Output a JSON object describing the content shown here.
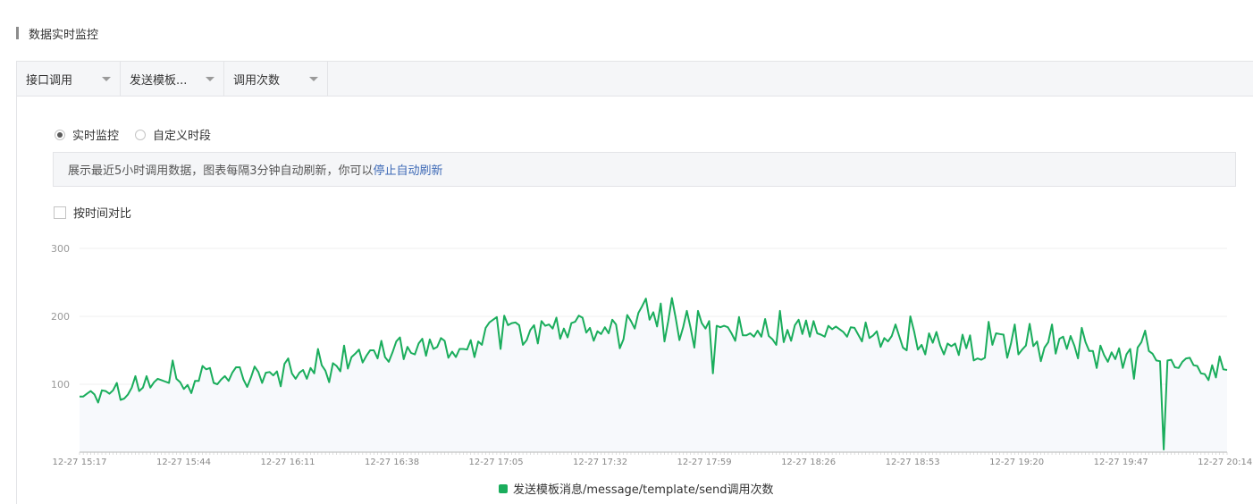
{
  "section": {
    "title": "数据实时监控"
  },
  "toolbar": {
    "dropdowns": [
      {
        "label": "接口调用"
      },
      {
        "label": "发送模板..."
      },
      {
        "label": "调用次数"
      }
    ]
  },
  "mode": {
    "options": [
      {
        "label": "实时监控",
        "checked": true
      },
      {
        "label": "自定义时段",
        "checked": false
      }
    ]
  },
  "info": {
    "text": "展示最近5小时调用数据，图表每隔3分钟自动刷新，你可以",
    "link": "停止自动刷新"
  },
  "compare": {
    "label": "按时间对比",
    "checked": false
  },
  "colors": {
    "line": "#1aad5c",
    "area": "#f7f9fc",
    "grid": "#efefef",
    "axis": "#b5b5b5"
  },
  "chart_data": {
    "type": "line",
    "title": "",
    "xlabel": "",
    "ylabel": "",
    "ylim": [
      0,
      300
    ],
    "yticks": [
      100,
      200,
      300
    ],
    "xticks": [
      "12-27 15:17",
      "12-27 15:44",
      "12-27 16:11",
      "12-27 16:38",
      "12-27 17:05",
      "12-27 17:32",
      "12-27 17:59",
      "12-27 18:26",
      "12-27 18:53",
      "12-27 19:20",
      "12-27 19:47",
      "12-27 20:14"
    ],
    "grid": true,
    "legend": "bottom-center",
    "series": [
      {
        "name": "发送模板消息/message/template/send调用次数",
        "values": [
          82,
          82,
          86,
          90,
          85,
          73,
          91,
          90,
          86,
          91,
          102,
          77,
          79,
          85,
          95,
          112,
          90,
          95,
          112,
          95,
          103,
          108,
          106,
          104,
          102,
          135,
          108,
          103,
          93,
          99,
          87,
          105,
          105,
          127,
          122,
          124,
          102,
          100,
          107,
          112,
          105,
          117,
          125,
          125,
          107,
          96,
          110,
          126,
          118,
          102,
          117,
          118,
          113,
          119,
          97,
          130,
          138,
          116,
          108,
          117,
          121,
          108,
          124,
          116,
          152,
          128,
          120,
          103,
          131,
          127,
          119,
          157,
          123,
          140,
          145,
          151,
          132,
          142,
          150,
          150,
          138,
          164,
          140,
          133,
          147,
          163,
          169,
          137,
          155,
          146,
          144,
          160,
          167,
          142,
          166,
          152,
          155,
          168,
          164,
          139,
          148,
          140,
          152,
          152,
          151,
          165,
          140,
          163,
          158,
          183,
          191,
          195,
          199,
          152,
          201,
          187,
          190,
          191,
          187,
          158,
          165,
          180,
          187,
          160,
          193,
          186,
          188,
          182,
          198,
          167,
          182,
          169,
          190,
          192,
          201,
          198,
          176,
          183,
          164,
          178,
          174,
          184,
          175,
          195,
          188,
          153,
          166,
          202,
          193,
          182,
          205,
          215,
          226,
          195,
          206,
          185,
          219,
          163,
          193,
          227,
          198,
          165,
          184,
          208,
          183,
          154,
          208,
          190,
          182,
          193,
          116,
          186,
          184,
          186,
          184,
          175,
          164,
          199,
          172,
          172,
          175,
          170,
          179,
          170,
          196,
          171,
          166,
          158,
          208,
          162,
          180,
          164,
          187,
          195,
          174,
          194,
          170,
          193,
          175,
          173,
          170,
          186,
          181,
          185,
          181,
          177,
          170,
          184,
          183,
          173,
          163,
          191,
          168,
          172,
          178,
          155,
          168,
          163,
          171,
          188,
          171,
          154,
          150,
          200,
          178,
          151,
          158,
          144,
          175,
          161,
          177,
          157,
          144,
          160,
          156,
          160,
          143,
          173,
          153,
          172,
          135,
          138,
          136,
          139,
          192,
          158,
          175,
          174,
          173,
          139,
          160,
          188,
          144,
          151,
          157,
          189,
          156,
          163,
          134,
          154,
          162,
          188,
          145,
          167,
          170,
          152,
          171,
          157,
          138,
          183,
          162,
          149,
          149,
          124,
          157,
          143,
          133,
          147,
          137,
          153,
          124,
          144,
          152,
          108,
          154,
          162,
          179,
          149,
          145,
          135,
          134,
          4,
          135,
          136,
          125,
          124,
          133,
          138,
          139,
          128,
          127,
          116,
          115,
          106,
          128,
          110,
          141,
          122,
          121
        ]
      }
    ]
  }
}
